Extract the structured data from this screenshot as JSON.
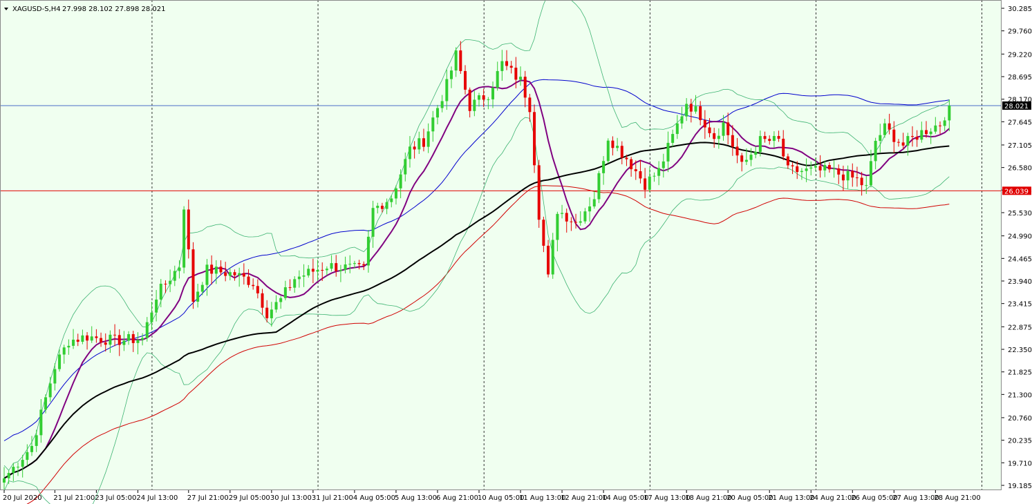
{
  "header": {
    "symbol": "XAGUSD-S,H4",
    "ohlc": "27.998 28.102 27.898 28.021"
  },
  "colors": {
    "background": "#f0fff0",
    "bull": "#32cd32",
    "bear": "#e60000",
    "bb_inner": "#3cb371",
    "ma_fast": "#800080",
    "ma_mid": "#000000",
    "env_upper": "#0000cd",
    "env_lower": "#d00000",
    "bid_line": "#4a6dc8",
    "level_line": "#e00000"
  },
  "chart_data": {
    "type": "candlestick",
    "symbol": "XAGUSD-S",
    "timeframe": "H4",
    "ylim": [
      19.185,
      30.285
    ],
    "y_ticks": [
      "30.285",
      "29.760",
      "29.220",
      "28.695",
      "28.170",
      "27.645",
      "27.105",
      "26.580",
      "26.055",
      "25.530",
      "24.990",
      "24.465",
      "23.940",
      "23.415",
      "22.875",
      "22.350",
      "21.825",
      "21.300",
      "20.760",
      "20.235",
      "19.710",
      "19.185"
    ],
    "x_ticks": [
      {
        "i": 0,
        "label": "20 Jul 2020"
      },
      {
        "i": 11,
        "label": "21 Jul 21:00"
      },
      {
        "i": 20,
        "label": "23 Jul 05:00"
      },
      {
        "i": 29,
        "label": "24 Jul 13:00"
      },
      {
        "i": 40,
        "label": "27 Jul 21:00"
      },
      {
        "i": 49,
        "label": "29 Jul 05:00"
      },
      {
        "i": 58,
        "label": "30 Jul 13:00"
      },
      {
        "i": 67,
        "label": "31 Jul 21:00"
      },
      {
        "i": 76,
        "label": "4 Aug 05:00"
      },
      {
        "i": 85,
        "label": "5 Aug 13:00"
      },
      {
        "i": 94,
        "label": "6 Aug 21:00"
      },
      {
        "i": 103,
        "label": "10 Aug 05:00"
      },
      {
        "i": 112,
        "label": "11 Aug 13:00"
      },
      {
        "i": 121,
        "label": "12 Aug 21:00"
      },
      {
        "i": 130,
        "label": "14 Aug 05:00"
      },
      {
        "i": 139,
        "label": "17 Aug 13:00"
      },
      {
        "i": 148,
        "label": "18 Aug 21:00"
      },
      {
        "i": 157,
        "label": "20 Aug 05:00"
      },
      {
        "i": 166,
        "label": "21 Aug 13:00"
      },
      {
        "i": 175,
        "label": "24 Aug 21:00"
      },
      {
        "i": 184,
        "label": "26 Aug 05:00"
      },
      {
        "i": 193,
        "label": "27 Aug 13:00"
      },
      {
        "i": 202,
        "label": "28 Aug 21:00"
      }
    ],
    "day_separators": [
      32,
      68,
      104,
      140,
      176,
      212
    ],
    "price_labels": [
      {
        "value": 28.021,
        "label": "28.021",
        "kind": "bid"
      },
      {
        "value": 26.039,
        "label": "26.039",
        "kind": "level"
      }
    ],
    "waypoints": [
      [
        0,
        19.35
      ],
      [
        6,
        20.1
      ],
      [
        11,
        21.95
      ],
      [
        14,
        22.55
      ],
      [
        18,
        22.65
      ],
      [
        24,
        22.55
      ],
      [
        30,
        22.6
      ],
      [
        33,
        23.6
      ],
      [
        38,
        24.3
      ],
      [
        39,
        25.7
      ],
      [
        41,
        23.5
      ],
      [
        44,
        24.2
      ],
      [
        50,
        24.1
      ],
      [
        54,
        23.9
      ],
      [
        57,
        23.2
      ],
      [
        60,
        23.5
      ],
      [
        63,
        24.0
      ],
      [
        70,
        24.3
      ],
      [
        78,
        24.2
      ],
      [
        80,
        25.6
      ],
      [
        84,
        25.9
      ],
      [
        88,
        27.0
      ],
      [
        91,
        27.2
      ],
      [
        96,
        28.5
      ],
      [
        98,
        29.2
      ],
      [
        101,
        28.0
      ],
      [
        105,
        28.3
      ],
      [
        108,
        29.0
      ],
      [
        112,
        28.6
      ],
      [
        114,
        28.0
      ],
      [
        116,
        25.5
      ],
      [
        118,
        24.0
      ],
      [
        120,
        25.6
      ],
      [
        124,
        25.3
      ],
      [
        128,
        25.9
      ],
      [
        131,
        27.3
      ],
      [
        135,
        26.8
      ],
      [
        139,
        26.2
      ],
      [
        142,
        26.5
      ],
      [
        145,
        27.3
      ],
      [
        148,
        28.1
      ],
      [
        151,
        27.8
      ],
      [
        154,
        27.3
      ],
      [
        156,
        27.6
      ],
      [
        160,
        26.6
      ],
      [
        164,
        27.2
      ],
      [
        168,
        27.2
      ],
      [
        170,
        26.5
      ],
      [
        175,
        26.5
      ],
      [
        179,
        26.5
      ],
      [
        185,
        26.3
      ],
      [
        187,
        26.1
      ],
      [
        189,
        27.2
      ],
      [
        191,
        27.5
      ],
      [
        195,
        27.1
      ],
      [
        199,
        27.4
      ],
      [
        203,
        27.6
      ],
      [
        205,
        28.02
      ]
    ]
  }
}
